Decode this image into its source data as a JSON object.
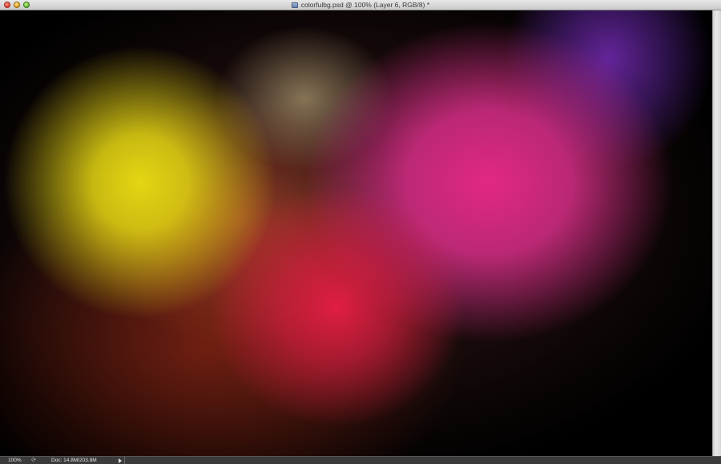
{
  "window": {
    "title": "colorfulbg.psd @ 100% (Layer 6, RGB/8) *"
  },
  "status": {
    "zoom": "100%",
    "doc_size": "Doc: 14.8M/203.8M",
    "rotate_icon": "rotate-icon",
    "menu_arrow_icon": "triangle-right-icon"
  },
  "canvas": {
    "description_colors": [
      "#e4d612",
      "#e81e46",
      "#e22882",
      "#6e28aa",
      "#000000"
    ]
  }
}
